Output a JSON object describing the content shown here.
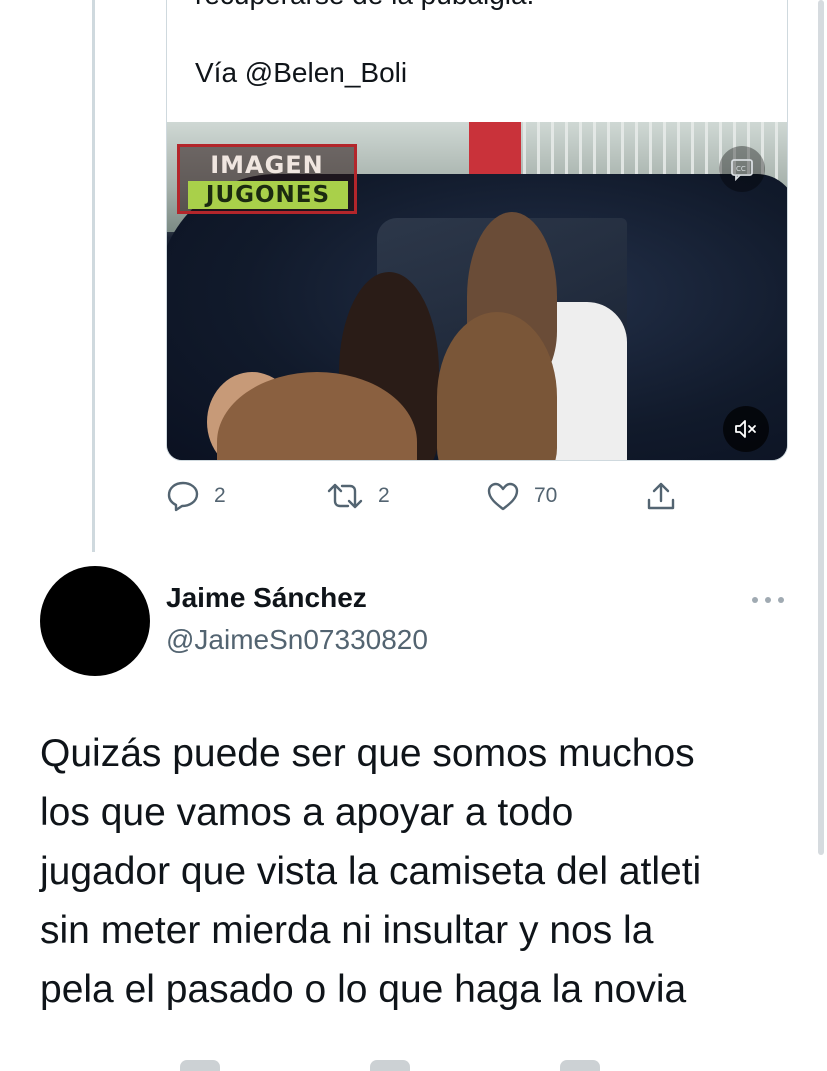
{
  "quoted_tweet": {
    "text_line": "recuperarse de la pubalgia.",
    "via": "Vía @Belen_Boli",
    "media": {
      "logo_top": "IMAGEN",
      "logo_bottom": "JUGONES",
      "cc_icon": "closed-captions-icon",
      "mute_icon": "volume-muted-icon"
    },
    "actions": {
      "reply_count": "2",
      "retweet_count": "2",
      "like_count": "70"
    }
  },
  "reply_tweet": {
    "author_name": "Jaime Sánchez",
    "author_handle": "@JaimeSn07330820",
    "text_lines": [
      "Quizás puede ser que somos muchos",
      "los que vamos a apoyar a todo",
      "jugador que vista la camiseta del atleti",
      "sin meter mierda ni insultar y nos la",
      "pela el pasado o lo que haga la novia"
    ]
  },
  "colors": {
    "text_primary": "#0f1419",
    "text_secondary": "#536471",
    "border": "#cfd9de",
    "logo_green": "#a9d04a",
    "logo_red": "#b3262b"
  }
}
